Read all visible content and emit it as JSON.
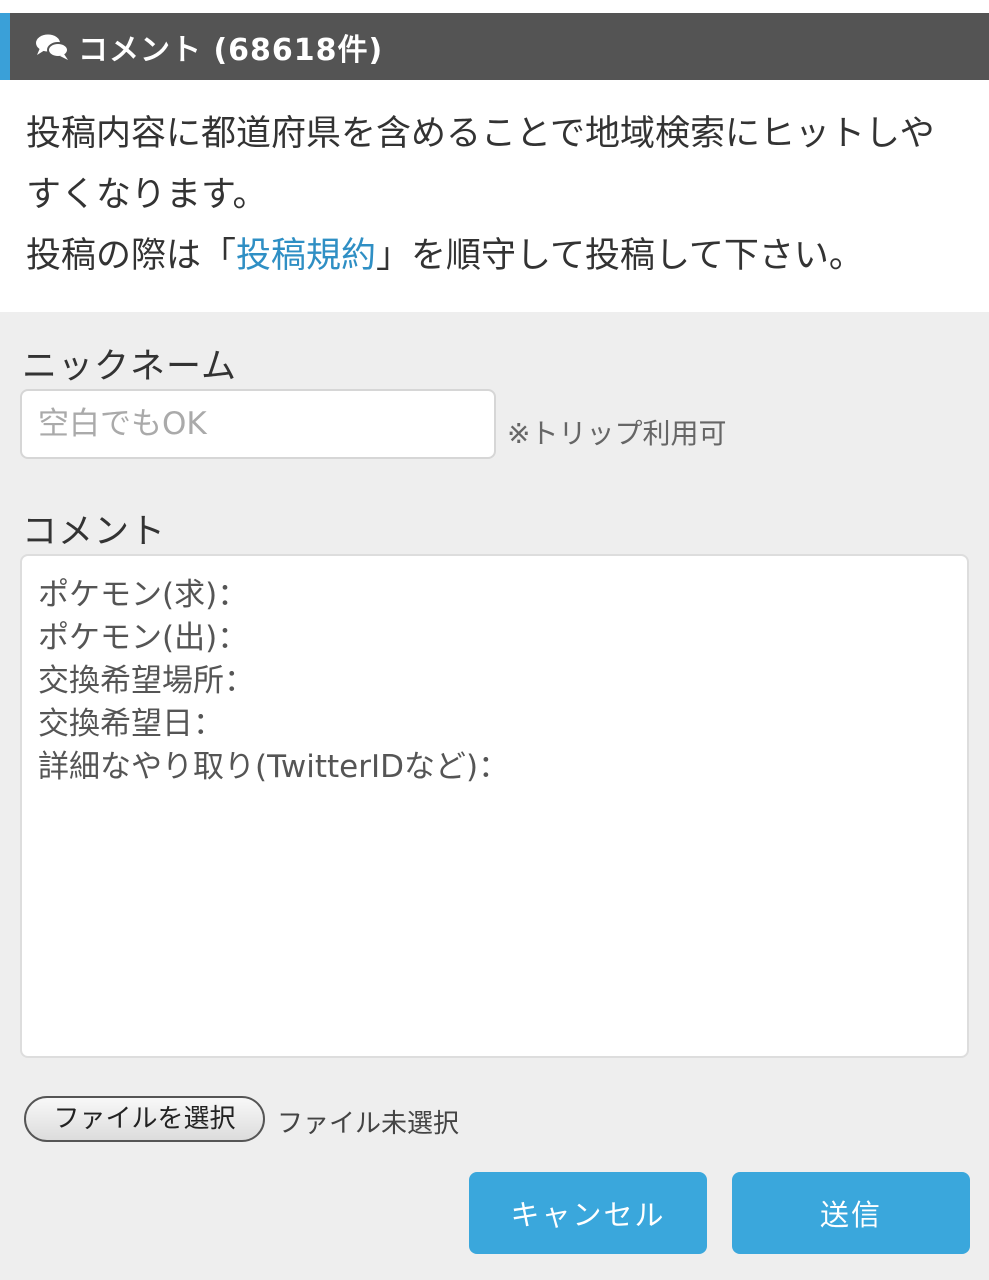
{
  "header": {
    "title": "コメント (68618件)",
    "icon": "comments-icon"
  },
  "notice": {
    "line1": "投稿内容に都道府県を含めることで地域検索にヒットしやすくなります。",
    "line2_before": "投稿の際は「",
    "line2_link": "投稿規約",
    "line2_after": "」を順守して投稿して下さい。"
  },
  "form": {
    "nickname_label": "ニックネーム",
    "nickname_placeholder": "空白でもOK",
    "nickname_value": "",
    "trip_note": "※トリップ利用可",
    "comment_label": "コメント",
    "comment_value": "ポケモン(求)：\nポケモン(出)：\n交換希望場所：\n交換希望日：\n詳細なやり取り(TwitterIDなど)：",
    "file_button_label": "ファイルを選択",
    "file_status": "ファイル未選択",
    "cancel_label": "キャンセル",
    "submit_label": "送信"
  },
  "colors": {
    "header_bg": "#545454",
    "header_accent": "#3aa0d8",
    "link": "#2f8fc4",
    "button": "#3aa7dc",
    "form_bg": "#eeeeee"
  }
}
